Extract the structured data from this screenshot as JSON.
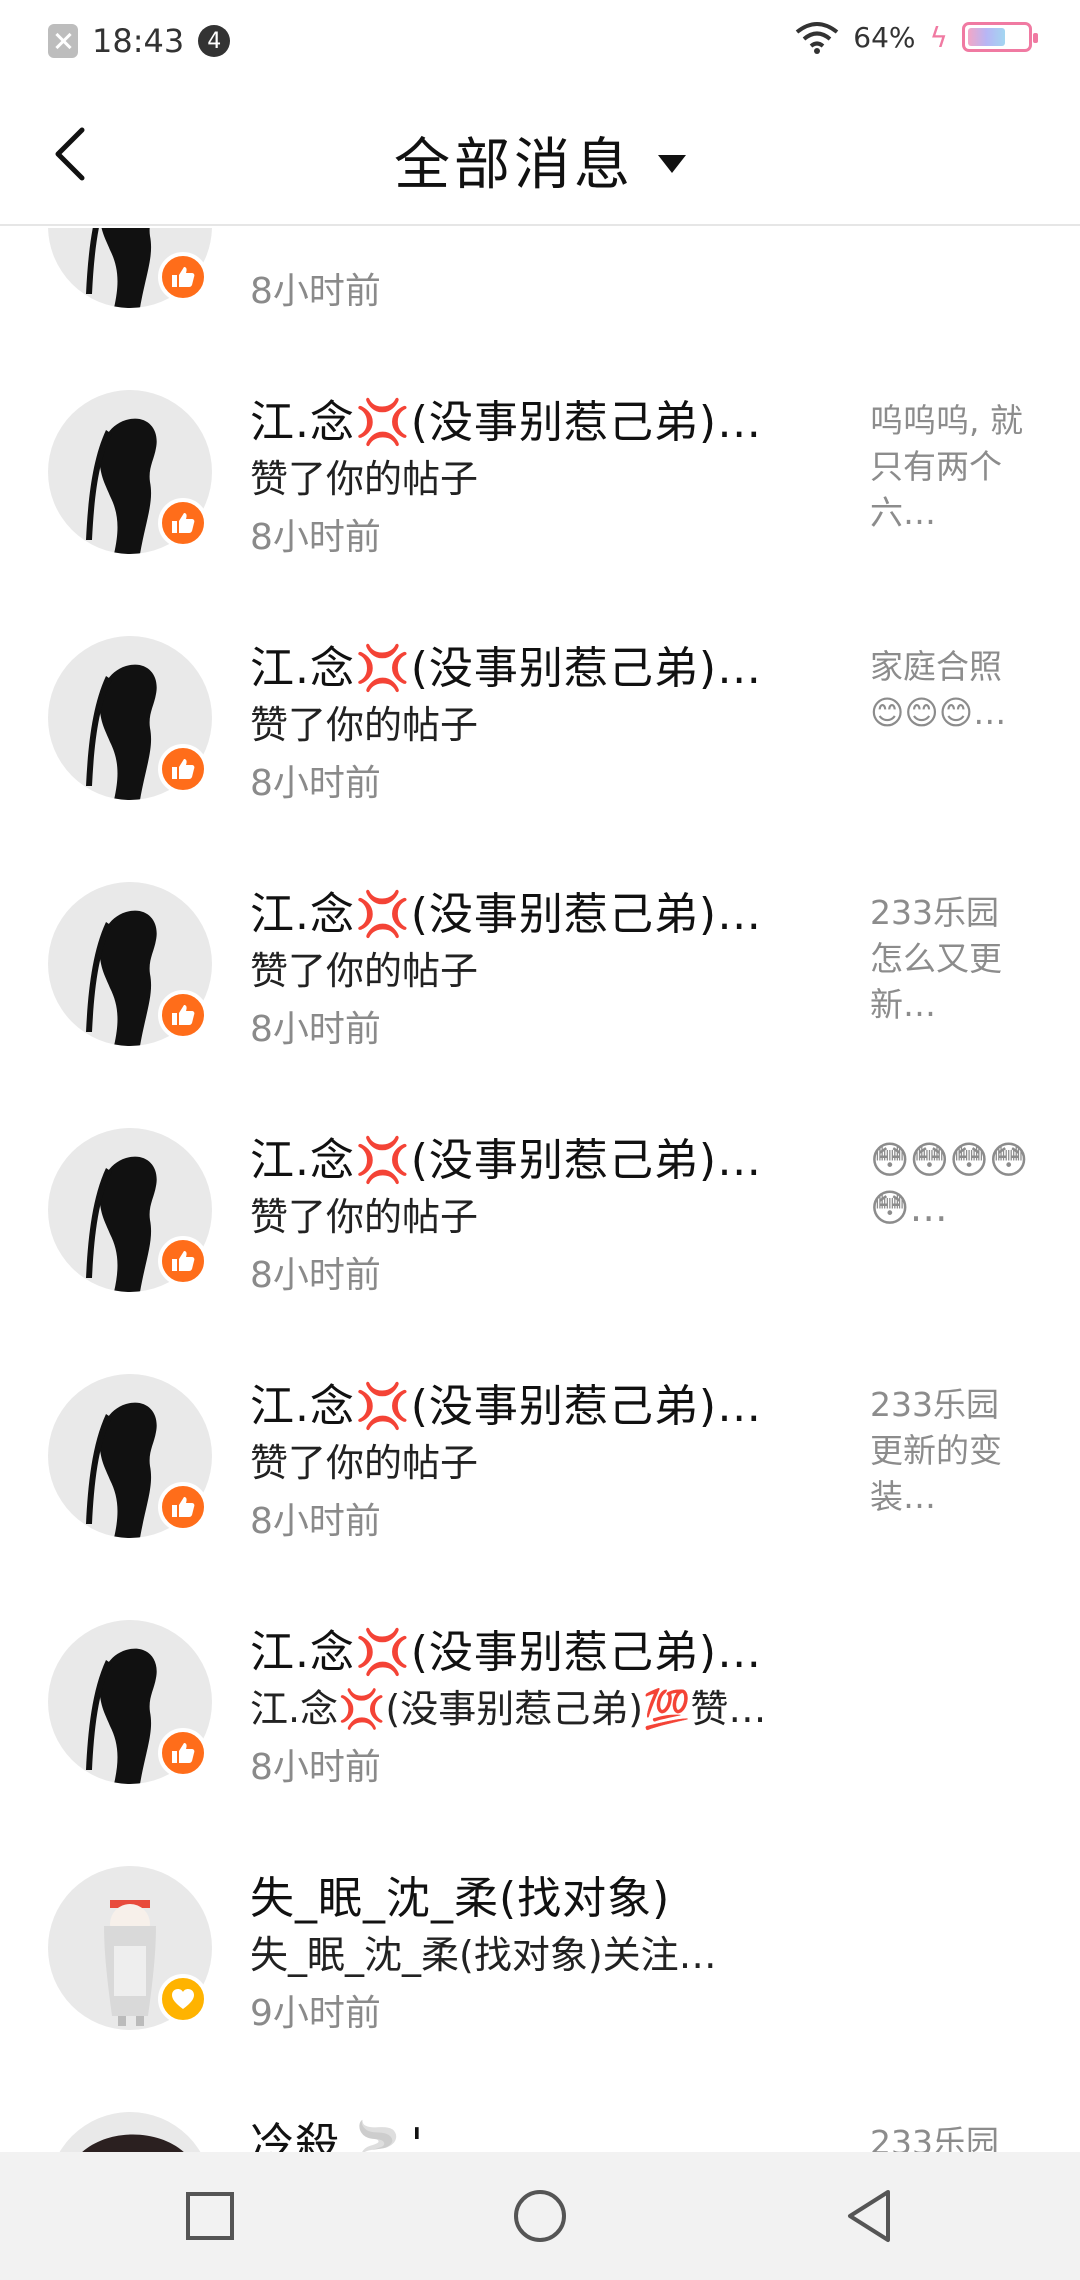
{
  "status_bar": {
    "time": "18:43",
    "notification_count": "4",
    "battery_percent": "64%",
    "battery_level": 0.64,
    "accent_color": "#f07aa2"
  },
  "header": {
    "back_icon": "chevron-left-icon",
    "title": "全部消息",
    "dropdown_icon": "triangle-down-icon"
  },
  "messages": [
    {
      "name": "",
      "action": "",
      "time": "8小时前",
      "preview": "😏…",
      "badge": "like"
    },
    {
      "name": "江.念💢(没事别惹己弟)…",
      "action": "赞了你的帖子",
      "time": "8小时前",
      "preview": "呜呜呜, 就只有两个六…",
      "badge": "like"
    },
    {
      "name": "江.念💢(没事别惹己弟)…",
      "action": "赞了你的帖子",
      "time": "8小时前",
      "preview": "家庭合照😊😊😊…",
      "badge": "like"
    },
    {
      "name": "江.念💢(没事别惹己弟)…",
      "action": "赞了你的帖子",
      "time": "8小时前",
      "preview": "233乐园怎么又更新…",
      "badge": "like"
    },
    {
      "name": "江.念💢(没事别惹己弟)…",
      "action": "赞了你的帖子",
      "time": "8小时前",
      "preview": "😳😳😳😳😳…",
      "badge": "like"
    },
    {
      "name": "江.念💢(没事别惹己弟)…",
      "action": "赞了你的帖子",
      "time": "8小时前",
      "preview": "233乐园更新的变装…",
      "badge": "like"
    },
    {
      "name": "江.念💢(没事别惹己弟)…",
      "action": "江.念💢(没事别惹己弟)💯赞…",
      "time": "8小时前",
      "preview": "",
      "badge": "like"
    },
    {
      "name": "失_眠_沈_柔(找对象)",
      "action": "失_眠_沈_柔(找对象)关注…",
      "time": "9小时前",
      "preview": "",
      "badge": "heart"
    },
    {
      "name": "冷殺.🚬'",
      "action": "",
      "time": "",
      "preview": "233乐园",
      "badge": "none"
    }
  ],
  "nav": {
    "recent_icon": "square-icon",
    "home_icon": "circle-icon",
    "back_icon": "triangle-back-icon"
  }
}
